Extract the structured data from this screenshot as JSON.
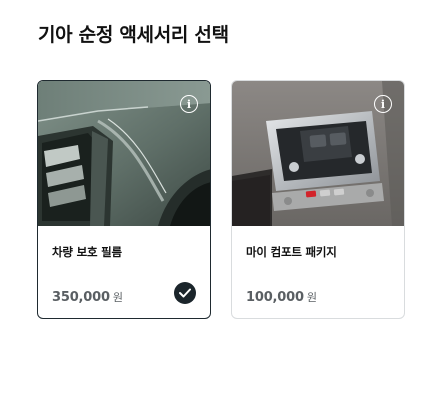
{
  "page": {
    "title": "기아 순정 액세서리 선택"
  },
  "accessories": [
    {
      "name": "차량 보호 필름",
      "price": "350,000",
      "currency": "원",
      "selected": true,
      "info_icon": "info-icon",
      "image": "car-side-protection-film"
    },
    {
      "name": "마이 컴포트 패키지",
      "price": "100,000",
      "currency": "원",
      "selected": false,
      "info_icon": "info-icon",
      "image": "interior-overhead-console"
    }
  ],
  "colors": {
    "selected_border": "#1f2a30",
    "check_badge": "#1b252b",
    "price_text": "#5a5f63"
  }
}
